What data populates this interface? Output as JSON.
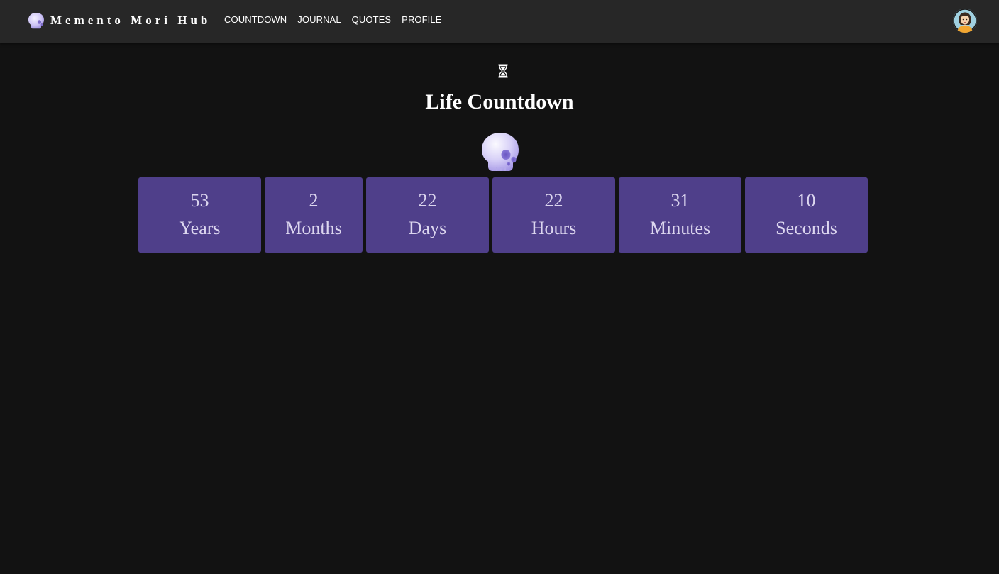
{
  "brand": {
    "title": "Memento Mori Hub",
    "icon": "skull-icon"
  },
  "nav": {
    "items": [
      {
        "label": "COUNTDOWN"
      },
      {
        "label": "JOURNAL"
      },
      {
        "label": "QUOTES"
      },
      {
        "label": "PROFILE"
      }
    ]
  },
  "user": {
    "avatar_icon": "user-avatar-icon"
  },
  "main": {
    "header_icon": "hourglass-icon",
    "title": "Life Countdown",
    "skull_icon": "skull-icon",
    "countdown": [
      {
        "value": "53",
        "unit": "Years"
      },
      {
        "value": "2",
        "unit": "Months"
      },
      {
        "value": "22",
        "unit": "Days"
      },
      {
        "value": "22",
        "unit": "Hours"
      },
      {
        "value": "31",
        "unit": "Minutes"
      },
      {
        "value": "10",
        "unit": "Seconds"
      }
    ]
  },
  "colors": {
    "background": "#121212",
    "navbar": "#272727",
    "box": "#4f3f8a",
    "box_text": "#dcd6ef",
    "accent_skull": "#c9c0f2"
  }
}
